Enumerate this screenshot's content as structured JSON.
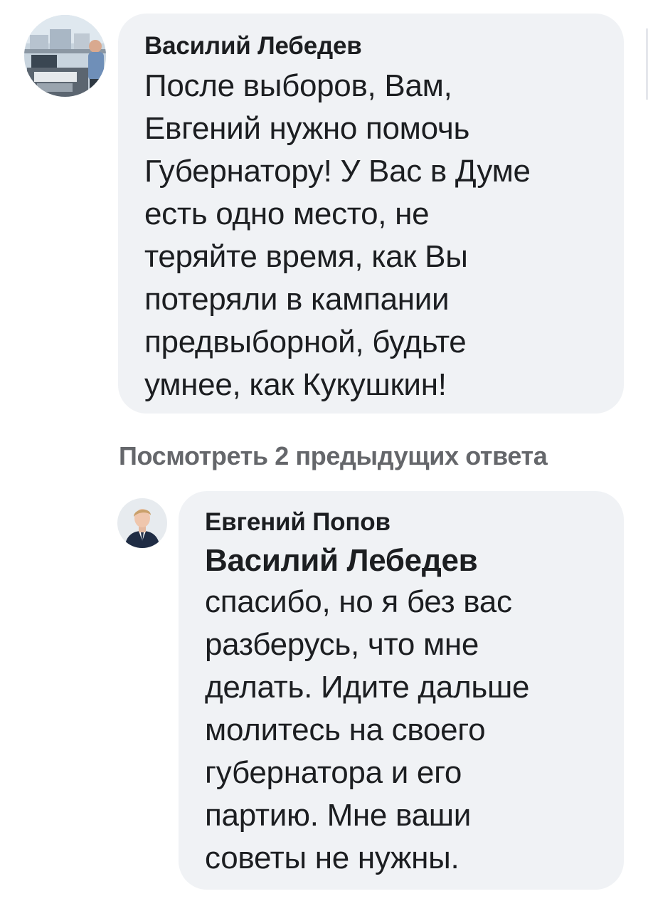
{
  "comments": [
    {
      "author": "Василий Лебедев",
      "text": "После выборов, Вам,\nЕвгений нужно помочь\nГубернатору! У Вас в Думе\nесть одно место, не\nтеряйте время, как Вы\nпотеряли в кампании\nпредвыборной, будьте\nумнее, как Кукушкин!"
    }
  ],
  "view_previous_replies": "Посмотреть 2 предыдущих ответа",
  "replies": [
    {
      "author": "Евгений Попов",
      "mention": "Василий Лебедев",
      "text": "спасибо, но я без вас\nразберусь, что мне\nделать. Идите дальше\nмолитесь на своего\nгубернатора и его\nпартию. Мне ваши\nсоветы не нужны."
    }
  ],
  "colors": {
    "bubble_bg": "#f0f2f5",
    "text": "#1c1e21",
    "secondary_text": "#65676b"
  }
}
